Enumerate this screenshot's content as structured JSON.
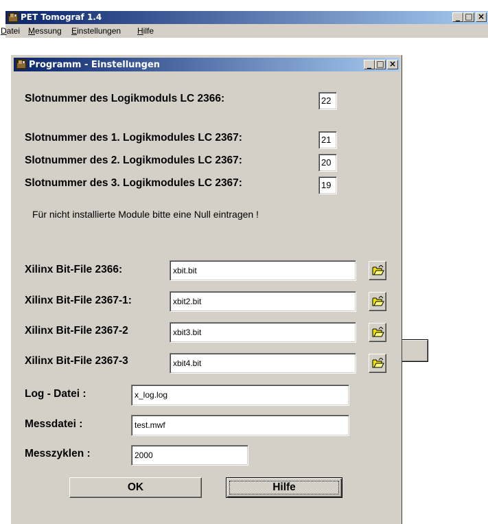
{
  "main_window": {
    "title": "PET Tomograf 1.4",
    "menu": [
      {
        "pre": "",
        "u": "D",
        "post": "atei"
      },
      {
        "pre": "",
        "u": "M",
        "post": "essung"
      },
      {
        "pre": "",
        "u": "E",
        "post": "instellungen"
      },
      {
        "pre": "",
        "u": "H",
        "post": "ilfe"
      }
    ],
    "caption": {
      "min": "_",
      "max": "□",
      "close": "×"
    }
  },
  "dialog": {
    "title": "Programm - Einstellungen",
    "caption": {
      "min": "_",
      "max": "□",
      "close": "×"
    },
    "slot_lc2366_label": "Slotnummer des Logikmoduls LC 2366:",
    "slot_lc2366_value": "22",
    "slot_lc2367_1_label": "Slotnummer des 1. Logikmodules LC 2367:",
    "slot_lc2367_1_value": "21",
    "slot_lc2367_2_label": "Slotnummer des 2. Logikmodules LC 2367:",
    "slot_lc2367_2_value": "20",
    "slot_lc2367_3_label": "Slotnummer des 3. Logikmodules LC 2367:",
    "slot_lc2367_3_value": "19",
    "hint": "Für nicht installierte Module bitte eine Null eintragen !",
    "xilinx_2366_label": "Xilinx Bit-File 2366:",
    "xilinx_2366_value": "xbit.bit",
    "xilinx_2367_1_label": "Xilinx Bit-File 2367-1:",
    "xilinx_2367_1_value": "xbit2.bit",
    "xilinx_2367_2_label": "Xilinx Bit-File 2367-2",
    "xilinx_2367_2_value": "xbit3.bit",
    "xilinx_2367_3_label": "Xilinx Bit-File 2367-3",
    "xilinx_2367_3_value": "xbit4.bit",
    "log_label": "Log - Datei :",
    "log_value": "x_log.log",
    "mess_label": "Messdatei :",
    "mess_value": "test.mwf",
    "zyklen_label": "Messzyklen :",
    "zyklen_value": "2000",
    "ok_label": "OK",
    "hilfe_label": "Hilfe"
  }
}
